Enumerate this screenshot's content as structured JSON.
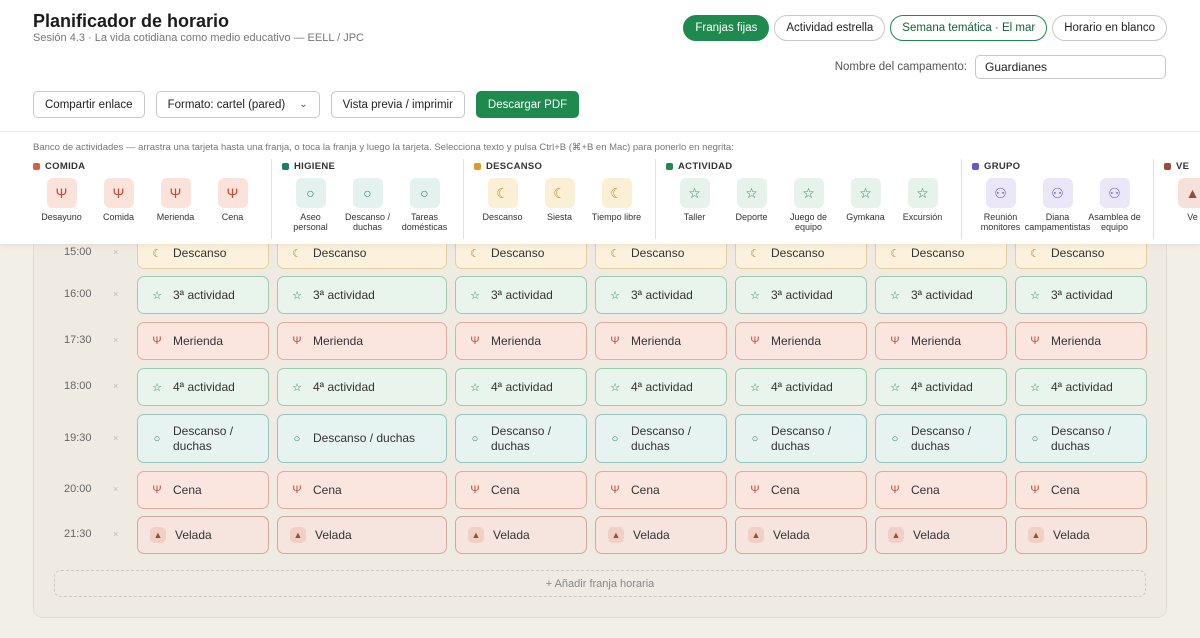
{
  "header": {
    "title": "Planificador de horario",
    "subtitle": "Sesión 4.3 · La vida cotidiana como medio educativo — EELL / JPC"
  },
  "modes": [
    "Franjas fijas",
    "Actividad estrella",
    "Semana temática · El mar",
    "Horario en blanco"
  ],
  "camp": {
    "label": "Nombre del campamento:",
    "value": "Guardianes"
  },
  "toolbar": {
    "share": "Compartir enlace",
    "format": "Formato: cartel (pared)",
    "preview": "Vista previa / imprimir",
    "download": "Descargar PDF"
  },
  "bank": {
    "hint": "Banco de actividades — arrastra una tarjeta hasta una franja, o toca la franja y luego la tarjeta. Selecciona texto y pulsa Ctrl+B (⌘+B en Mac) para ponerlo en negrita:",
    "categories": [
      {
        "name": "COMIDA",
        "color": "#d9603a",
        "icon": "utensils-icon",
        "bg": "#fbe3dc",
        "fg": "#c44f35",
        "items": [
          "Desayuno",
          "Comida",
          "Merienda",
          "Cena"
        ]
      },
      {
        "name": "HIGIENE",
        "color": "#1f7a6b",
        "icon": "drop-icon",
        "bg": "#e3f1ef",
        "fg": "#2a8073",
        "items": [
          "Aseo personal",
          "Descanso / duchas",
          "Tareas domésticas"
        ]
      },
      {
        "name": "DESCANSO",
        "color": "#dd9a2b",
        "icon": "moon-icon",
        "bg": "#fbefd6",
        "fg": "#c08d2a",
        "items": [
          "Descanso",
          "Siesta",
          "Tiempo libre"
        ]
      },
      {
        "name": "ACTIVIDAD",
        "color": "#1e8a4e",
        "icon": "star-icon",
        "bg": "#e5f3ea",
        "fg": "#1e8a4e",
        "items": [
          "Taller",
          "Deporte",
          "Juego de equipo",
          "Gymkana",
          "Excursión"
        ]
      },
      {
        "name": "GRUPO",
        "color": "#6b57c9",
        "icon": "people-icon",
        "bg": "#ebe7f8",
        "fg": "#6b57c9",
        "items": [
          "Reunión monitores",
          "Diana campamentistas",
          "Asamblea de equipo"
        ]
      },
      {
        "name": "VE",
        "color": "#9c4b35",
        "icon": "fire-icon",
        "bg": "#f6e1da",
        "fg": "#9c4b35",
        "items": [
          "Ve"
        ]
      }
    ]
  },
  "schedule": {
    "rows": [
      {
        "time": "15:00",
        "type": "descanso",
        "label": "Descanso",
        "label_wide": "Descanso"
      },
      {
        "time": "16:00",
        "type": "actividad",
        "label": "3ª actividad",
        "label_wide": "3ª actividad"
      },
      {
        "time": "17:30",
        "type": "comida",
        "label": "Merienda",
        "label_wide": "Merienda"
      },
      {
        "time": "18:00",
        "type": "actividad",
        "label": "4ª actividad",
        "label_wide": "4ª actividad"
      },
      {
        "time": "19:30",
        "type": "higiene",
        "label": "Descanso / duchas",
        "label_wide": "Descanso / duchas"
      },
      {
        "time": "20:00",
        "type": "comida",
        "label": "Cena",
        "label_wide": "Cena"
      },
      {
        "time": "21:30",
        "type": "velada",
        "label": "Velada",
        "label_wide": "Velada"
      }
    ],
    "remove_mark": "×",
    "add_slot": "+ Añadir franja horaria"
  }
}
